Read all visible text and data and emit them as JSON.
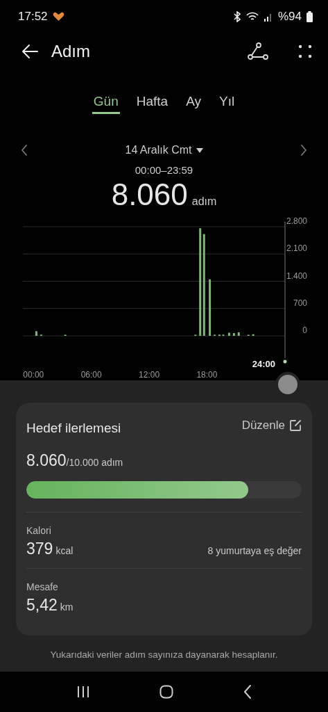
{
  "status_bar": {
    "time": "17:52",
    "battery": "%94"
  },
  "header": {
    "title": "Adım"
  },
  "tabs": [
    {
      "label": "Gün",
      "selected": true
    },
    {
      "label": "Hafta",
      "selected": false
    },
    {
      "label": "Ay",
      "selected": false
    },
    {
      "label": "Yıl",
      "selected": false
    }
  ],
  "date": {
    "label": "14 Aralık Cmt",
    "range": "00:00–23:59",
    "total": "8.060",
    "unit": "adım"
  },
  "chart": {
    "cursor_label": "24:00",
    "chart_data": {
      "type": "bar",
      "x": [
        0.3,
        0.8,
        3.3,
        16.8,
        17.3,
        17.7,
        18.3,
        18.8,
        19.3,
        19.7,
        20.3,
        20.8,
        21.3,
        22.3,
        22.8
      ],
      "values": [
        120,
        30,
        20,
        10,
        2760,
        2610,
        1450,
        10,
        30,
        30,
        80,
        70,
        90,
        20,
        40
      ],
      "xlim": [
        -1.1,
        26.1
      ],
      "ylim": [
        0,
        2800
      ],
      "grid": true,
      "xticks": [
        {
          "value": 0,
          "label": "00:00"
        },
        {
          "value": 6,
          "label": "06:00"
        },
        {
          "value": 12,
          "label": "12:00"
        },
        {
          "value": 18,
          "label": "18:00"
        }
      ],
      "yticks": [
        {
          "value": 0,
          "label": "0"
        },
        {
          "value": 700,
          "label": "700"
        },
        {
          "value": 1400,
          "label": "1.400"
        },
        {
          "value": 2100,
          "label": "2.100"
        },
        {
          "value": 2800,
          "label": "2.800"
        }
      ]
    }
  },
  "goal_card": {
    "title": "Hedef ilerlemesi",
    "edit": "Düzenle",
    "value": "8.060",
    "target": "/10.000 adım",
    "level": 0.806,
    "stats": [
      {
        "label": "Kalori",
        "value": "379",
        "unit": "kcal",
        "note": "8 yumurtaya eş değer"
      },
      {
        "label": "Mesafe",
        "value": "5,42",
        "unit": "km"
      }
    ]
  },
  "footnote": "Yukarıdaki veriler adım sayınıza dayanarak hesaplanır."
}
